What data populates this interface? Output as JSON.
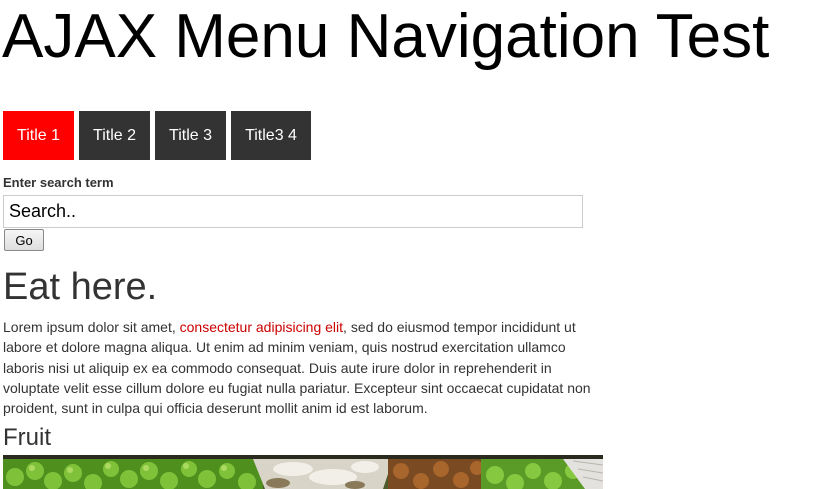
{
  "header": {
    "title": "AJAX Menu Navigation Test"
  },
  "nav": {
    "tabs": [
      {
        "label": "Title 1",
        "active": true
      },
      {
        "label": "Title 2",
        "active": false
      },
      {
        "label": "Title 3",
        "active": false
      },
      {
        "label": "Title3 4",
        "active": false
      }
    ]
  },
  "search": {
    "label": "Enter search term",
    "placeholder": "Search..",
    "value": "",
    "button_label": "Go"
  },
  "content": {
    "heading": "Eat here.",
    "paragraph_before_link": "Lorem ipsum dolor sit amet, ",
    "paragraph_link": "consectetur adipisicing elit",
    "paragraph_after_link": ", sed do eiusmod tempor incididunt ut labore et dolore magna aliqua. Ut enim ad minim veniam, quis nostrud exercitation ullamco laboris nisi ut aliquip ex ea commodo consequat. Duis aute irure dolor in reprehenderit in voluptate velit esse cillum dolore eu fugiat nulla pariatur. Excepteur sint occaecat cupidatat non proident, sunt in culpa qui officia deserunt mollit anim id est laborum.",
    "subheading": "Fruit"
  },
  "colors": {
    "active_tab": "#ff0000",
    "tab": "#333333",
    "link": "#cc0000"
  }
}
